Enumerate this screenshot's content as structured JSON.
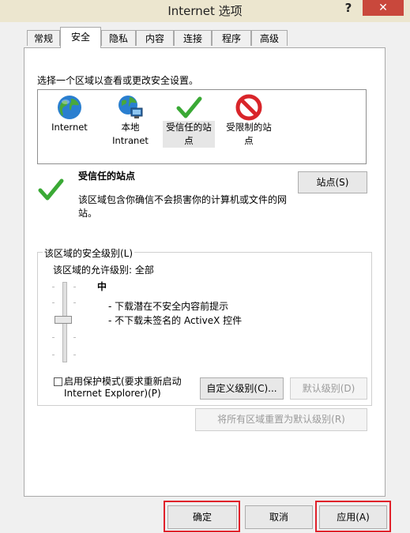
{
  "window": {
    "title": "Internet 选项",
    "help_label": "?",
    "close_label": "✕"
  },
  "tabs": [
    {
      "label": "常规",
      "active": false
    },
    {
      "label": "安全",
      "active": true
    },
    {
      "label": "隐私",
      "active": false
    },
    {
      "label": "内容",
      "active": false
    },
    {
      "label": "连接",
      "active": false
    },
    {
      "label": "程序",
      "active": false
    },
    {
      "label": "高级",
      "active": false
    }
  ],
  "security": {
    "instruction": "选择一个区域以查看或更改安全设置。",
    "zones": [
      {
        "line1": "Internet",
        "line2": "",
        "icon": "globe-icon"
      },
      {
        "line1": "本地",
        "line2": "Intranet",
        "icon": "intranet-icon"
      },
      {
        "line1": "受信任的站",
        "line2": "点",
        "icon": "checkmark-icon",
        "selected": true
      },
      {
        "line1": "受限制的站",
        "line2": "点",
        "icon": "restricted-icon"
      }
    ],
    "selected_zone": {
      "title": "受信任的站点",
      "desc_line1": "该区域包含你确信不会损害你的计算机或文件的网",
      "desc_line2": "站。",
      "sites_button": "站点(S)"
    },
    "level_group": {
      "title": "该区域的安全级别(L)",
      "allowed": "该区域的允许级别: 全部",
      "level_name": "中",
      "bullet1": "- 下载潜在不安全内容前提示",
      "bullet2": "- 不下载未签名的 ActiveX 控件",
      "protected_line1": "启用保护模式(要求重新启动",
      "protected_line2": "Internet Explorer)(P)",
      "protected_checked": false,
      "custom_button": "自定义级别(C)...",
      "default_button": "默认级别(D)"
    },
    "reset_all_button": "将所有区域重置为默认级别(R)"
  },
  "footer": {
    "ok": "确定",
    "cancel": "取消",
    "apply": "应用(A)"
  },
  "colors": {
    "close_red": "#c9483c",
    "highlight_red": "#e0202a",
    "check_green": "#3aa935",
    "restricted_red": "#d9252a"
  }
}
